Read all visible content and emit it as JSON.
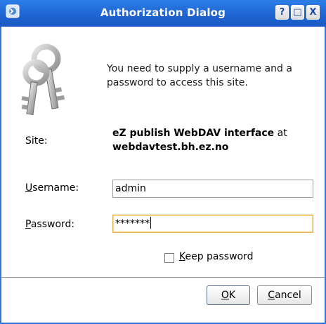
{
  "window": {
    "title": "Authorization Dialog",
    "title_icon": "kde-app-icon",
    "buttons": {
      "help": "?",
      "maximize": "□",
      "close": "X"
    }
  },
  "dialog": {
    "icon": "keys-icon",
    "message": "You need to supply a username and a password to access this site.",
    "site_label": "Site:",
    "site_name_bold": "eZ publish WebDAV interface",
    "site_at": " at",
    "site_host_bold": "webdavtest.bh.ez.no",
    "username_label_mnemonic": "U",
    "username_label_rest": "sername:",
    "username_value": "admin",
    "password_label_mnemonic": "P",
    "password_label_rest": "assword:",
    "password_masked": "*******",
    "keep_password_mnemonic": "K",
    "keep_password_rest": "eep password",
    "keep_password_checked": false
  },
  "buttons": {
    "ok_mnemonic": "O",
    "ok_rest": "K",
    "cancel_mnemonic": "C",
    "cancel_rest": "ancel"
  },
  "colors": {
    "titlebar": "#1f65d1",
    "focus_border": "#e9b44c"
  }
}
